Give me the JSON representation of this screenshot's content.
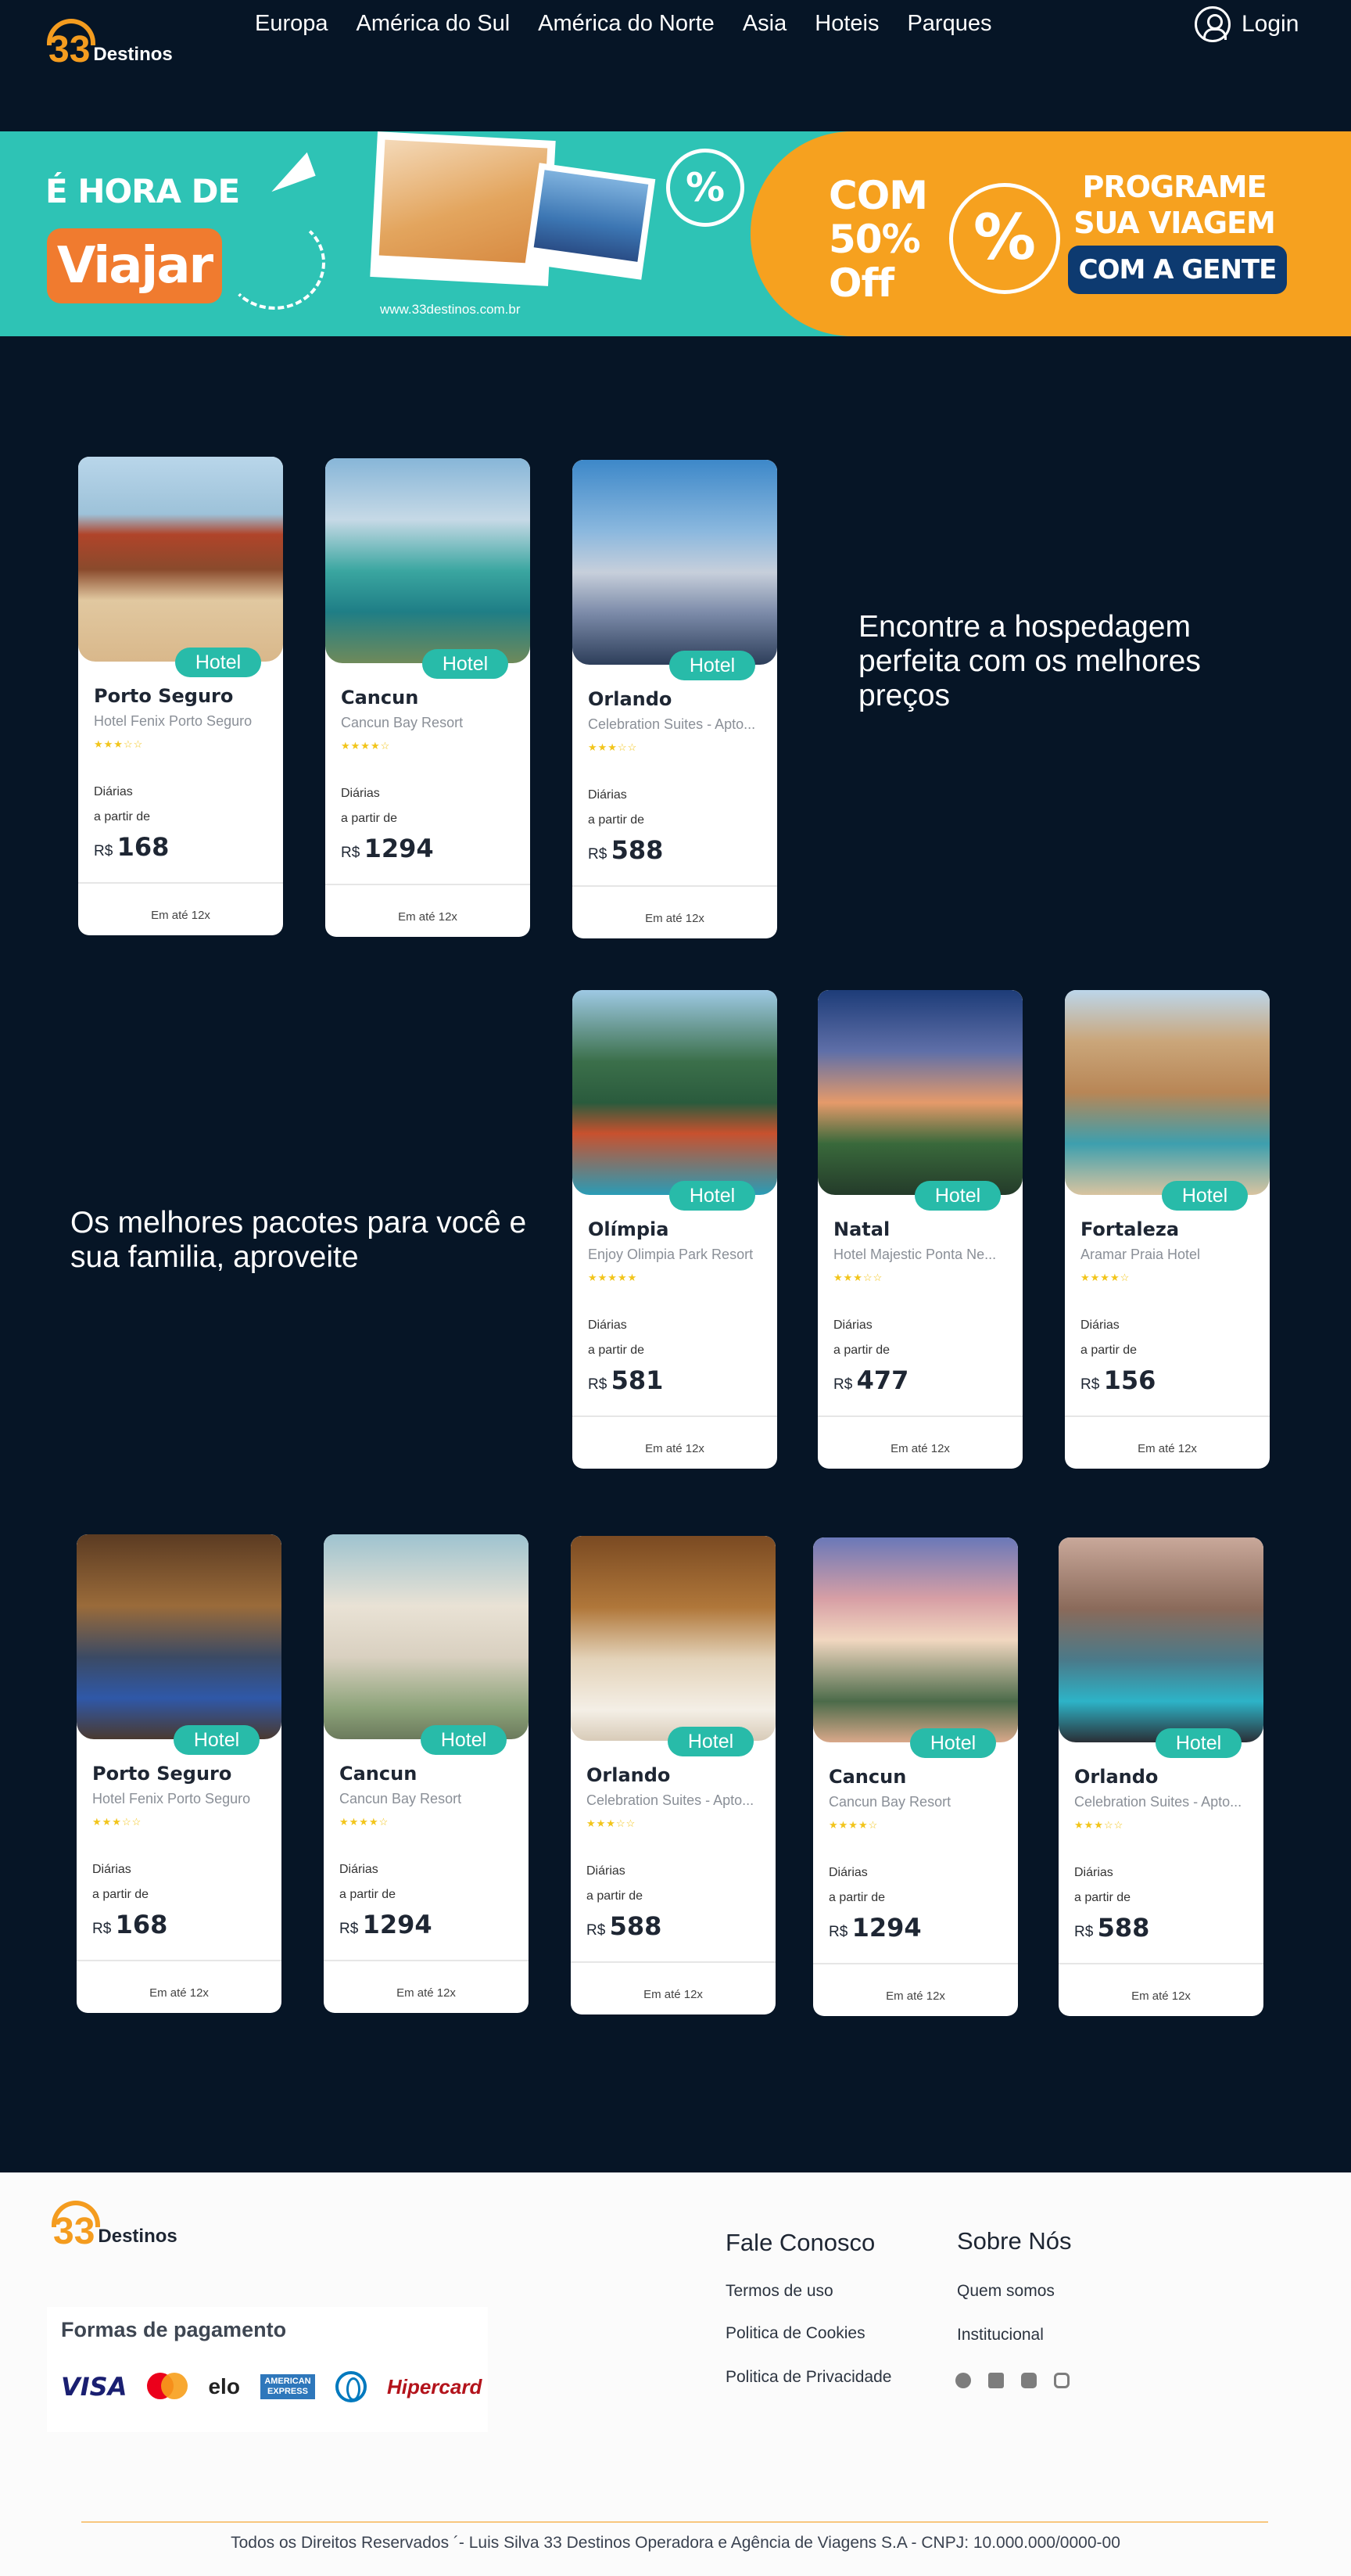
{
  "header": {
    "logo_number": "33",
    "logo_text": "Destinos",
    "nav": [
      "Europa",
      "América do Sul",
      "América do Norte",
      "Asia",
      "Hoteis",
      "Parques"
    ],
    "login": "Login"
  },
  "banner": {
    "line1": "É HORA DE",
    "highlight": "Viajar",
    "url": "www.33destinos.com.br",
    "discount_lines": [
      "COM",
      "50%",
      "Off"
    ],
    "cta_lines": [
      "PROGRAME",
      "SUA VIAGEM"
    ],
    "cta_box": "COM A GENTE",
    "percent_symbol": "%"
  },
  "section1": {
    "tagline": "Encontre a hospedagem perfeita com os melhores preços"
  },
  "section2": {
    "tagline": "Os melhores pacotes para você e sua familia, aproveite"
  },
  "card_labels": {
    "badge": "Hotel",
    "diarias": "Diárias",
    "a_partir": "a partir de",
    "currency": "R$",
    "installments": "Em até 12x"
  },
  "cards": [
    {
      "city": "Porto Seguro",
      "hotel": "Hotel Fenix Porto Seguro",
      "stars": "★★★☆☆",
      "price": "168"
    },
    {
      "city": "Cancun",
      "hotel": "Cancun Bay Resort",
      "stars": "★★★★☆",
      "price": "1294"
    },
    {
      "city": "Orlando",
      "hotel": "Celebration Suites - Apto...",
      "stars": "★★★☆☆",
      "price": "588"
    },
    {
      "city": "Olímpia",
      "hotel": "Enjoy Olimpia Park Resort",
      "stars": "★★★★★",
      "price": "581"
    },
    {
      "city": "Natal",
      "hotel": "Hotel Majestic Ponta Ne...",
      "stars": "★★★☆☆",
      "price": "477"
    },
    {
      "city": "Fortaleza",
      "hotel": "Aramar Praia Hotel",
      "stars": "★★★★☆",
      "price": "156"
    },
    {
      "city": "Porto Seguro",
      "hotel": "Hotel Fenix Porto Seguro",
      "stars": "★★★☆☆",
      "price": "168"
    },
    {
      "city": "Cancun",
      "hotel": "Cancun Bay Resort",
      "stars": "★★★★☆",
      "price": "1294"
    },
    {
      "city": "Orlando",
      "hotel": "Celebration Suites - Apto...",
      "stars": "★★★☆☆",
      "price": "588"
    },
    {
      "city": "Cancun",
      "hotel": "Cancun Bay Resort",
      "stars": "★★★★☆",
      "price": "1294"
    },
    {
      "city": "Orlando",
      "hotel": "Celebration Suites - Apto...",
      "stars": "★★★☆☆",
      "price": "588"
    }
  ],
  "footer": {
    "pay_title": "Formas de pagamento",
    "pay_methods": [
      "VISA",
      "mastercard",
      "elo",
      "AMERICAN EXPRESS",
      "Diners Club",
      "Hipercard"
    ],
    "contact_title": "Fale Conosco",
    "contact_links": [
      "Termos de uso",
      "Politica de Cookies",
      "Politica de Privacidade"
    ],
    "about_title": "Sobre Nós",
    "about_links": [
      "Quem somos",
      "Institucional"
    ],
    "social": [
      "facebook-icon",
      "linkedin-icon",
      "youtube-icon",
      "instagram-icon"
    ],
    "copyright": "Todos os Direitos Reservados  ´- Luis Silva 33 Destinos Operadora e Agência de Viagens S.A - CNPJ: 10.000.000/0000-00"
  },
  "colors": {
    "bg": "#061526",
    "accent": "#28bba9",
    "orange": "#f6a11f",
    "teal": "#2ec3b5"
  }
}
